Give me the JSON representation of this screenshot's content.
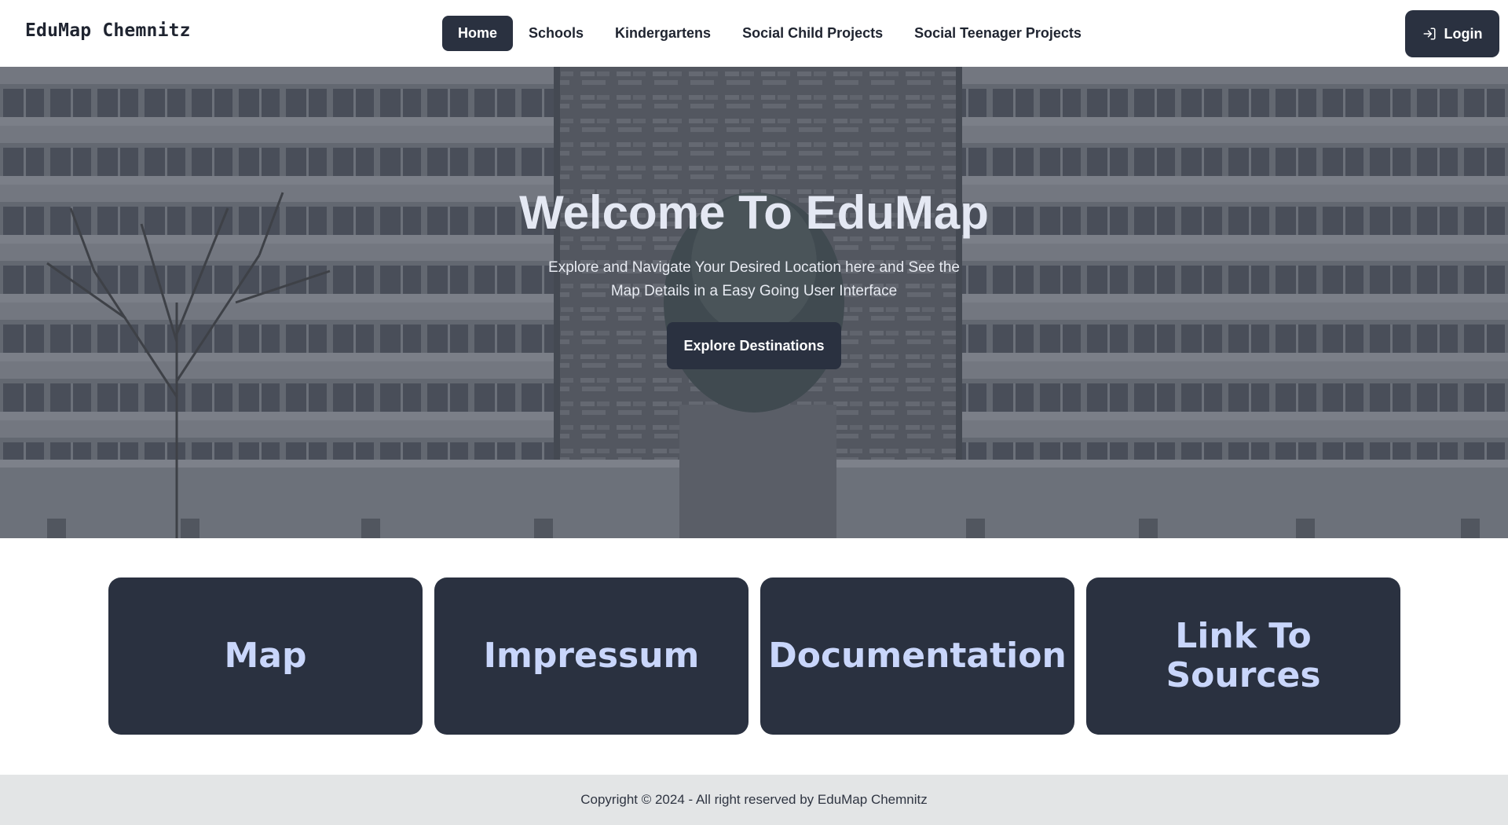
{
  "app": {
    "brand": "EduMap Chemnitz"
  },
  "nav": {
    "items": [
      {
        "label": "Home",
        "active": true
      },
      {
        "label": "Schools",
        "active": false
      },
      {
        "label": "Kindergartens",
        "active": false
      },
      {
        "label": "Social Child Projects",
        "active": false
      },
      {
        "label": "Social Teenager Projects",
        "active": false
      }
    ],
    "login_label": "Login",
    "login_icon": "login-icon"
  },
  "hero": {
    "title": "Welcome To EduMap",
    "subtitle": "Explore and Navigate Your Desired Location here and See the Map Details in a Easy Going User Interface",
    "cta_label": "Explore Destinations"
  },
  "cards": [
    {
      "label": "Map"
    },
    {
      "label": "Impressum"
    },
    {
      "label": "Documentation"
    },
    {
      "label": "Link To Sources"
    }
  ],
  "footer": {
    "copyright": "Copyright © 2024 - All right reserved by EduMap Chemnitz"
  },
  "colors": {
    "primary_dark": "#2a3140",
    "card_text": "#c9d6fb",
    "hero_title": "#e4e8f3",
    "footer_bg": "#e3e5e6"
  }
}
